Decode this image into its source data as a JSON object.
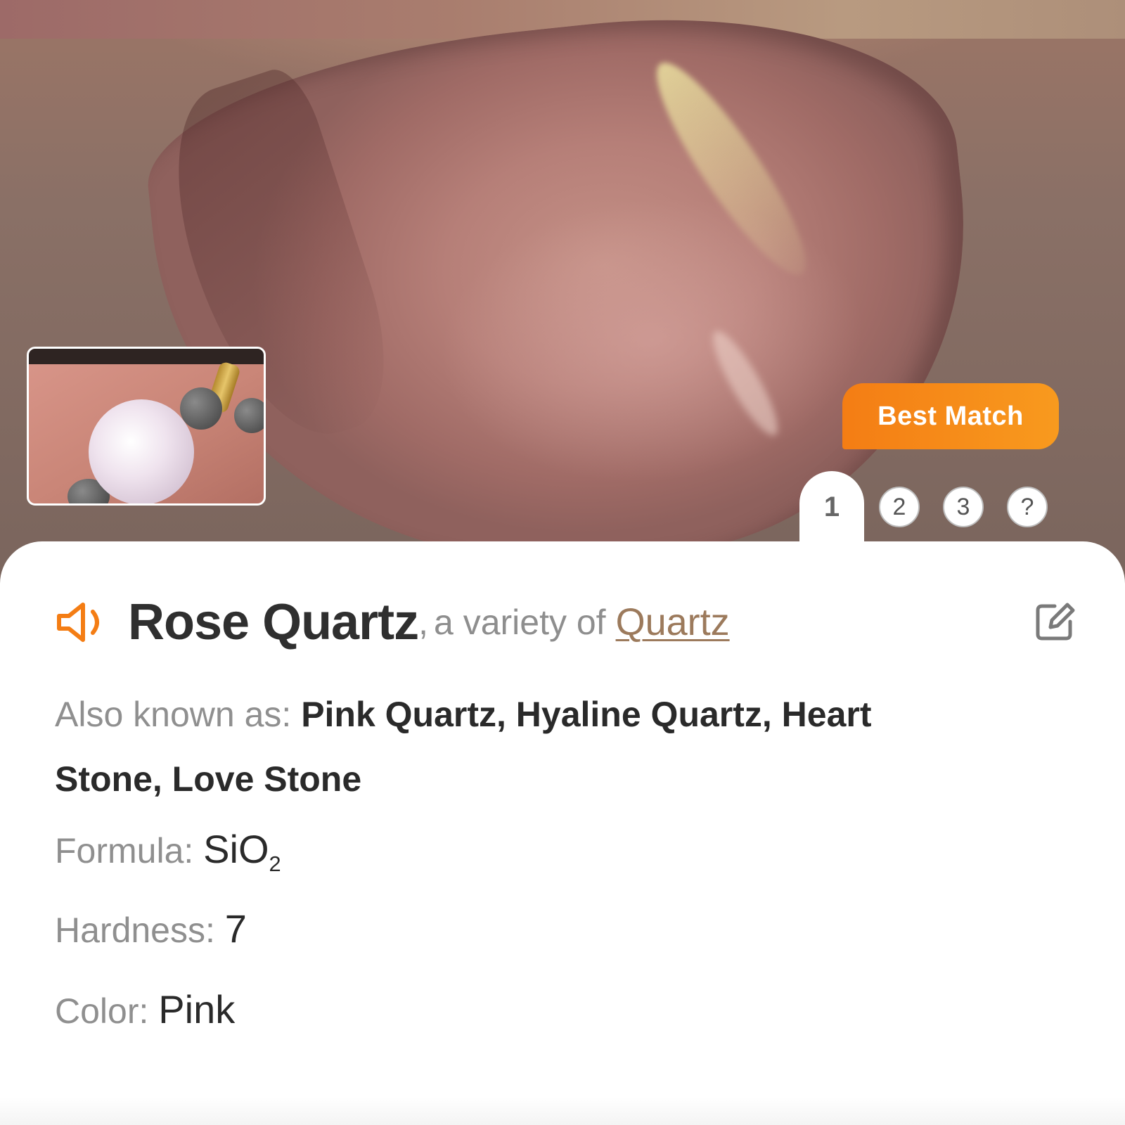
{
  "hero": {
    "badge": "Best Match",
    "pager": [
      "1",
      "2",
      "3",
      "?"
    ]
  },
  "result": {
    "name": "Rose Quartz",
    "separator": ",",
    "variety_prefix": "a variety of",
    "variety_link": "Quartz",
    "aka_label": "Also known as:",
    "aka_value": "Pink Quartz, Hyaline Quartz, Heart Stone, Love Stone",
    "formula_label": "Formula:",
    "formula_base": "SiO",
    "formula_sub": "2",
    "hardness_label": "Hardness:",
    "hardness_value": "7",
    "color_label": "Color:",
    "color_value": "Pink"
  },
  "colors": {
    "accent": "#f47d14",
    "link": "#9c7a5c",
    "label": "#8f8f8f",
    "text": "#2a2a2a"
  },
  "icons": {
    "speaker": "speaker-icon",
    "edit": "edit-icon"
  }
}
